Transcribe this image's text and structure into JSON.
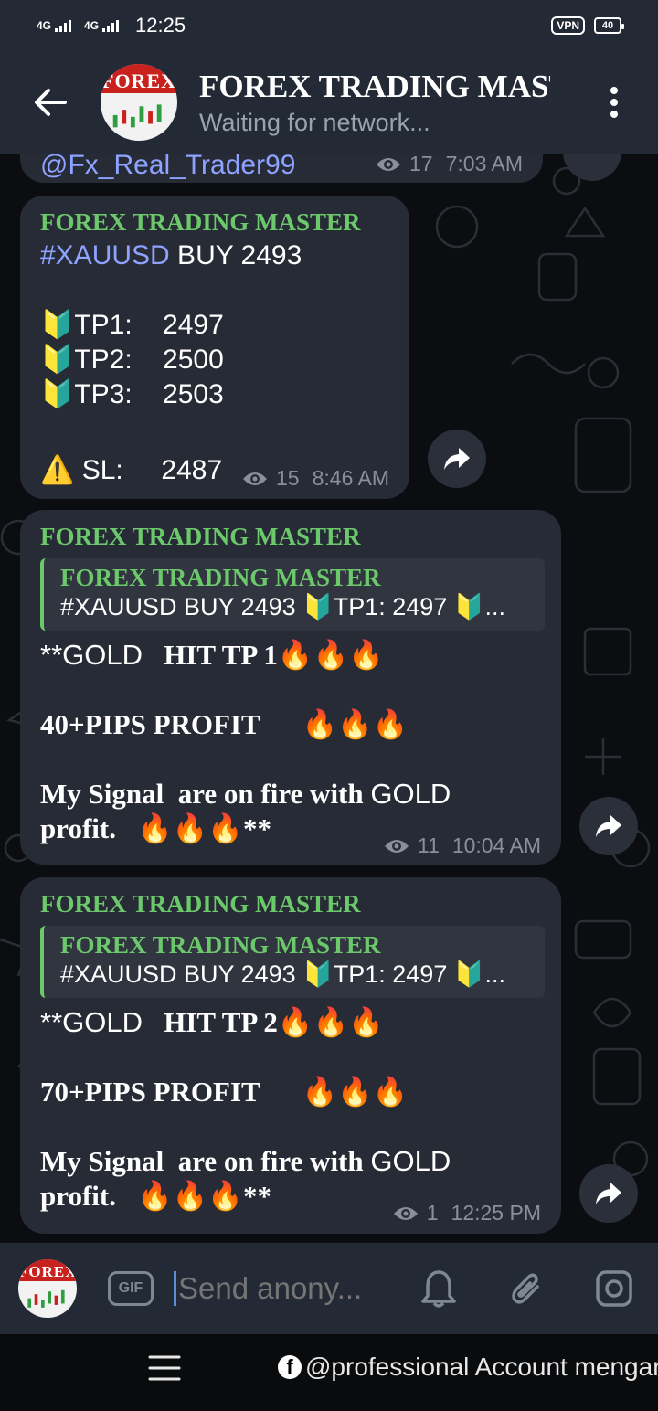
{
  "status_bar": {
    "net1": "4G",
    "net2": "4G",
    "time": "12:25",
    "vpn": "VPN",
    "battery": "40"
  },
  "header": {
    "title": "FOREX TRADING MASTER",
    "status": "Waiting for network...",
    "avatar_text": "FOREX"
  },
  "messages": {
    "partial": {
      "text": "@Fx_Real_Trader99",
      "views": "17",
      "time": "7:03 AM"
    },
    "signal": {
      "sender": "FOREX TRADING MASTER",
      "hashtag": "#XAUUSD",
      "order": " BUY 2493",
      "tp1": "🔰TP1:    2497",
      "tp2": "🔰TP2:    2500",
      "tp3": "🔰TP3:    2503",
      "sl": "⚠️ SL:     2487",
      "views": "15",
      "time": "8:46 AM"
    },
    "tp1_hit": {
      "sender": "FOREX TRADING MASTER",
      "reply_name": "FOREX TRADING MASTER",
      "reply_text": "#XAUUSD BUY 2493 🔰TP1:    2497 🔰...",
      "line1_a": "**GOLD",
      "line1_b": "   HIT TP 1🔥🔥🔥",
      "line2": "40+PIPS PROFIT      🔥🔥🔥",
      "line3_a": "My Signal  are on fire with ",
      "line3_b": "GOLD",
      "line4": "profit.   🔥🔥🔥**",
      "views": "11",
      "time": "10:04 AM"
    },
    "tp2_hit": {
      "sender": "FOREX TRADING MASTER",
      "reply_name": "FOREX TRADING MASTER",
      "reply_text": "#XAUUSD BUY 2493 🔰TP1:    2497 🔰...",
      "line1_a": "**GOLD",
      "line1_b": "   HIT TP 2🔥🔥🔥",
      "line2": "70+PIPS PROFIT      🔥🔥🔥",
      "line3_a": "My Signal  are on fire with ",
      "line3_b": "GOLD",
      "line4": "profit.   🔥🔥🔥**",
      "views": "1",
      "time": "12:25 PM"
    }
  },
  "input": {
    "gif_label": "GIF",
    "placeholder": "Send anony..."
  },
  "navbar": {
    "watermark": "@professional Account mengar"
  },
  "colors": {
    "bubble": "#272b35",
    "sender": "#6bc96b",
    "hashtag": "#8ea2ff",
    "header_bg": "#232a36"
  }
}
